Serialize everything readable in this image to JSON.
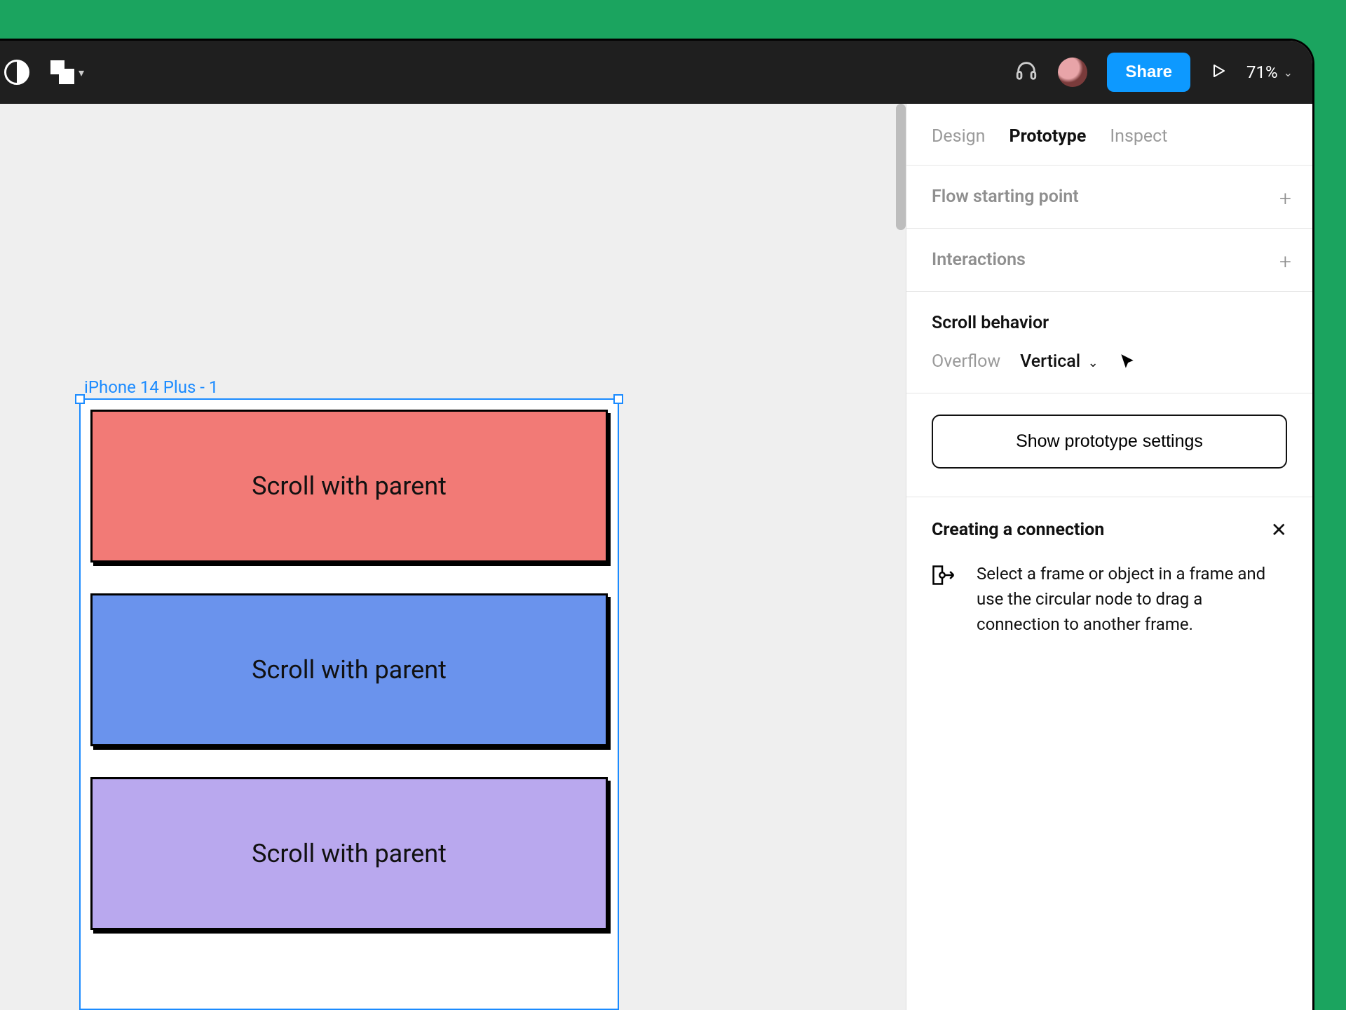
{
  "toolbar": {
    "share_label": "Share",
    "zoom": "71%"
  },
  "panel": {
    "tabs": [
      "Design",
      "Prototype",
      "Inspect"
    ],
    "active_tab": 1,
    "flow_section": "Flow starting point",
    "interactions_section": "Interactions",
    "scroll_section_title": "Scroll behavior",
    "overflow_label": "Overflow",
    "overflow_value": "Vertical",
    "settings_button": "Show prototype settings",
    "connection": {
      "title": "Creating a connection",
      "body": "Select a frame or object in a frame and use the circular node to drag a connection to another frame."
    }
  },
  "canvas": {
    "frame_label": "iPhone 14 Plus - 1",
    "rows": [
      {
        "text": "Scroll with parent",
        "color": "red"
      },
      {
        "text": "Scroll with parent",
        "color": "blue"
      },
      {
        "text": "Scroll with parent",
        "color": "purple"
      }
    ]
  }
}
